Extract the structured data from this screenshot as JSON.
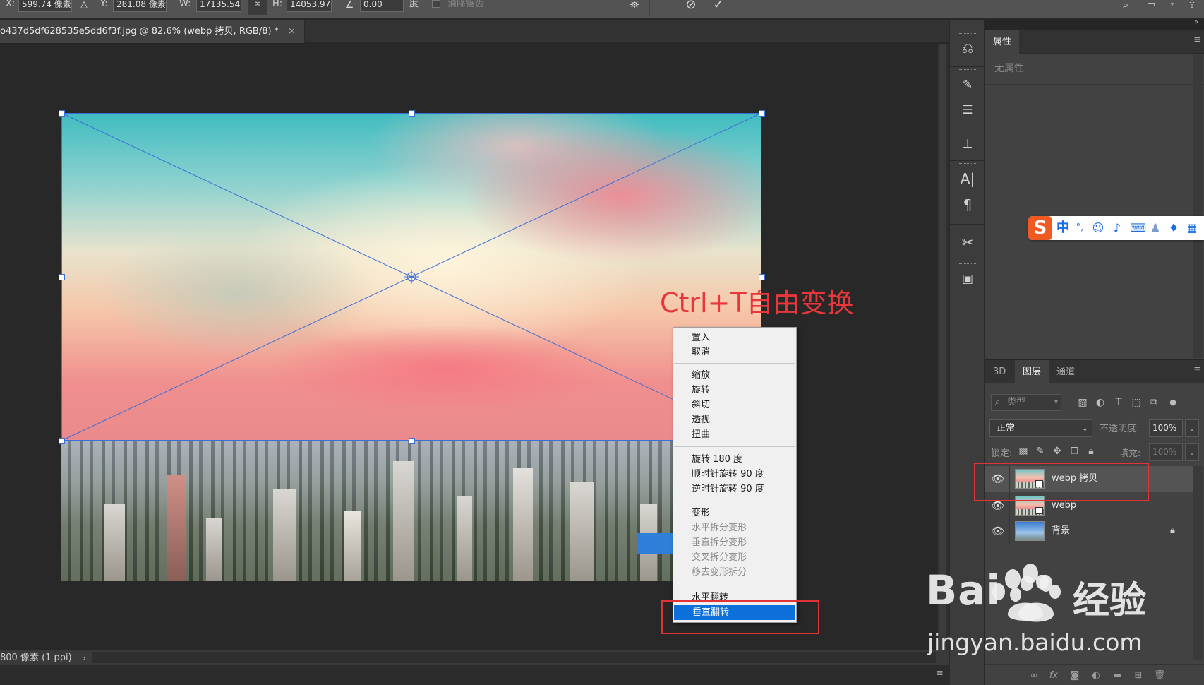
{
  "options_bar": {
    "x_label": "X:",
    "x_value": "599.74 像素",
    "y_label": "Y:",
    "y_value": "281.08 像素",
    "w_label": "W:",
    "w_value": "17135.54%",
    "h_label": "H:",
    "h_value": "14053.97%",
    "rotate_value": "0.00",
    "rotate_unit": "度",
    "antialias_label": "消除锯齿"
  },
  "document": {
    "tab_title": "o437d5df628535e5dd6f3f.jpg @ 82.6% (webp 拷贝, RGB/8) *",
    "close_glyph": "×"
  },
  "annotation": {
    "text": "Ctrl+T自由变换",
    "color": "#e8363a"
  },
  "context_menu": {
    "groups": [
      [
        {
          "label": "置入",
          "enabled": true
        },
        {
          "label": "取消",
          "enabled": true
        }
      ],
      [
        {
          "label": "缩放",
          "enabled": true
        },
        {
          "label": "旋转",
          "enabled": true
        },
        {
          "label": "斜切",
          "enabled": true
        },
        {
          "label": "透视",
          "enabled": true
        },
        {
          "label": "扭曲",
          "enabled": true
        }
      ],
      [
        {
          "label": "旋转 180 度",
          "enabled": true
        },
        {
          "label": "顺时针旋转 90 度",
          "enabled": true
        },
        {
          "label": "逆时针旋转 90 度",
          "enabled": true
        }
      ],
      [
        {
          "label": "变形",
          "enabled": true
        },
        {
          "label": "水平拆分变形",
          "enabled": false
        },
        {
          "label": "垂直拆分变形",
          "enabled": false
        },
        {
          "label": "交叉拆分变形",
          "enabled": false
        },
        {
          "label": "移去变形拆分",
          "enabled": false
        }
      ],
      [
        {
          "label": "水平翻转",
          "enabled": true
        },
        {
          "label": "垂直翻转",
          "enabled": true,
          "highlighted": true
        }
      ]
    ],
    "highlight_color": "#0d6fd9"
  },
  "status_bar": {
    "text": "800 像素 (1 ppi)",
    "arrow": "›"
  },
  "properties_panel": {
    "tab": "属性",
    "empty_text": "无属性"
  },
  "ime_toolbar": {
    "logo": "S",
    "mode": "中",
    "punct": "°,"
  },
  "layers_panel": {
    "tabs": [
      "3D",
      "图层",
      "通道"
    ],
    "active_tab": "图层",
    "filter_placeholder": "类型",
    "blend_mode": "正常",
    "opacity_label": "不透明度:",
    "opacity_value": "100%",
    "lock_label": "锁定:",
    "fill_label": "填充:",
    "fill_value": "100%",
    "layers": [
      {
        "name": "webp 拷贝",
        "visible": true,
        "selected": true,
        "type": "smart-object",
        "locked": false
      },
      {
        "name": "webp",
        "visible": true,
        "selected": false,
        "type": "smart-object",
        "locked": false
      },
      {
        "name": "背景",
        "visible": true,
        "selected": false,
        "type": "background",
        "locked": true
      }
    ]
  },
  "watermark": {
    "brand": "Bai",
    "brand_zh": "经验",
    "url": "jingyan.baidu.com"
  },
  "colors": {
    "workspace_bg": "#282828",
    "panel_bg": "#424242",
    "transform_line": "#3a6fd8",
    "callout_box": "#e03237"
  }
}
